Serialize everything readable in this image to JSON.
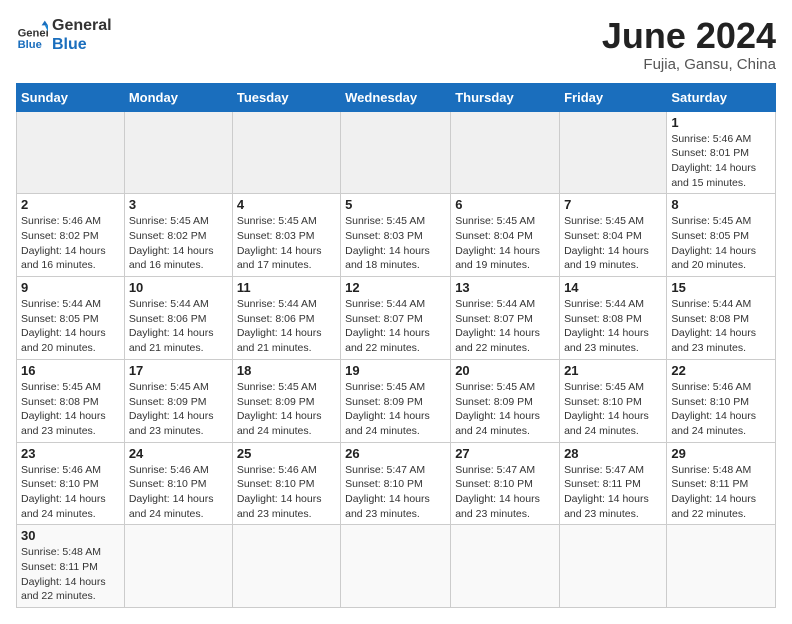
{
  "header": {
    "logo_general": "General",
    "logo_blue": "Blue",
    "month": "June 2024",
    "location": "Fujia, Gansu, China"
  },
  "weekdays": [
    "Sunday",
    "Monday",
    "Tuesday",
    "Wednesday",
    "Thursday",
    "Friday",
    "Saturday"
  ],
  "weeks": [
    [
      {
        "day": "",
        "info": ""
      },
      {
        "day": "",
        "info": ""
      },
      {
        "day": "",
        "info": ""
      },
      {
        "day": "",
        "info": ""
      },
      {
        "day": "",
        "info": ""
      },
      {
        "day": "",
        "info": ""
      },
      {
        "day": "1",
        "info": "Sunrise: 5:46 AM\nSunset: 8:01 PM\nDaylight: 14 hours and 15 minutes."
      }
    ],
    [
      {
        "day": "2",
        "info": "Sunrise: 5:46 AM\nSunset: 8:02 PM\nDaylight: 14 hours and 16 minutes."
      },
      {
        "day": "3",
        "info": "Sunrise: 5:45 AM\nSunset: 8:02 PM\nDaylight: 14 hours and 16 minutes."
      },
      {
        "day": "4",
        "info": "Sunrise: 5:45 AM\nSunset: 8:03 PM\nDaylight: 14 hours and 17 minutes."
      },
      {
        "day": "5",
        "info": "Sunrise: 5:45 AM\nSunset: 8:03 PM\nDaylight: 14 hours and 18 minutes."
      },
      {
        "day": "6",
        "info": "Sunrise: 5:45 AM\nSunset: 8:04 PM\nDaylight: 14 hours and 19 minutes."
      },
      {
        "day": "7",
        "info": "Sunrise: 5:45 AM\nSunset: 8:04 PM\nDaylight: 14 hours and 19 minutes."
      },
      {
        "day": "8",
        "info": "Sunrise: 5:45 AM\nSunset: 8:05 PM\nDaylight: 14 hours and 20 minutes."
      }
    ],
    [
      {
        "day": "9",
        "info": "Sunrise: 5:44 AM\nSunset: 8:05 PM\nDaylight: 14 hours and 20 minutes."
      },
      {
        "day": "10",
        "info": "Sunrise: 5:44 AM\nSunset: 8:06 PM\nDaylight: 14 hours and 21 minutes."
      },
      {
        "day": "11",
        "info": "Sunrise: 5:44 AM\nSunset: 8:06 PM\nDaylight: 14 hours and 21 minutes."
      },
      {
        "day": "12",
        "info": "Sunrise: 5:44 AM\nSunset: 8:07 PM\nDaylight: 14 hours and 22 minutes."
      },
      {
        "day": "13",
        "info": "Sunrise: 5:44 AM\nSunset: 8:07 PM\nDaylight: 14 hours and 22 minutes."
      },
      {
        "day": "14",
        "info": "Sunrise: 5:44 AM\nSunset: 8:08 PM\nDaylight: 14 hours and 23 minutes."
      },
      {
        "day": "15",
        "info": "Sunrise: 5:44 AM\nSunset: 8:08 PM\nDaylight: 14 hours and 23 minutes."
      }
    ],
    [
      {
        "day": "16",
        "info": "Sunrise: 5:45 AM\nSunset: 8:08 PM\nDaylight: 14 hours and 23 minutes."
      },
      {
        "day": "17",
        "info": "Sunrise: 5:45 AM\nSunset: 8:09 PM\nDaylight: 14 hours and 23 minutes."
      },
      {
        "day": "18",
        "info": "Sunrise: 5:45 AM\nSunset: 8:09 PM\nDaylight: 14 hours and 24 minutes."
      },
      {
        "day": "19",
        "info": "Sunrise: 5:45 AM\nSunset: 8:09 PM\nDaylight: 14 hours and 24 minutes."
      },
      {
        "day": "20",
        "info": "Sunrise: 5:45 AM\nSunset: 8:09 PM\nDaylight: 14 hours and 24 minutes."
      },
      {
        "day": "21",
        "info": "Sunrise: 5:45 AM\nSunset: 8:10 PM\nDaylight: 14 hours and 24 minutes."
      },
      {
        "day": "22",
        "info": "Sunrise: 5:46 AM\nSunset: 8:10 PM\nDaylight: 14 hours and 24 minutes."
      }
    ],
    [
      {
        "day": "23",
        "info": "Sunrise: 5:46 AM\nSunset: 8:10 PM\nDaylight: 14 hours and 24 minutes."
      },
      {
        "day": "24",
        "info": "Sunrise: 5:46 AM\nSunset: 8:10 PM\nDaylight: 14 hours and 24 minutes."
      },
      {
        "day": "25",
        "info": "Sunrise: 5:46 AM\nSunset: 8:10 PM\nDaylight: 14 hours and 23 minutes."
      },
      {
        "day": "26",
        "info": "Sunrise: 5:47 AM\nSunset: 8:10 PM\nDaylight: 14 hours and 23 minutes."
      },
      {
        "day": "27",
        "info": "Sunrise: 5:47 AM\nSunset: 8:10 PM\nDaylight: 14 hours and 23 minutes."
      },
      {
        "day": "28",
        "info": "Sunrise: 5:47 AM\nSunset: 8:11 PM\nDaylight: 14 hours and 23 minutes."
      },
      {
        "day": "29",
        "info": "Sunrise: 5:48 AM\nSunset: 8:11 PM\nDaylight: 14 hours and 22 minutes."
      }
    ],
    [
      {
        "day": "30",
        "info": "Sunrise: 5:48 AM\nSunset: 8:11 PM\nDaylight: 14 hours and 22 minutes."
      },
      {
        "day": "",
        "info": ""
      },
      {
        "day": "",
        "info": ""
      },
      {
        "day": "",
        "info": ""
      },
      {
        "day": "",
        "info": ""
      },
      {
        "day": "",
        "info": ""
      },
      {
        "day": "",
        "info": ""
      }
    ]
  ]
}
